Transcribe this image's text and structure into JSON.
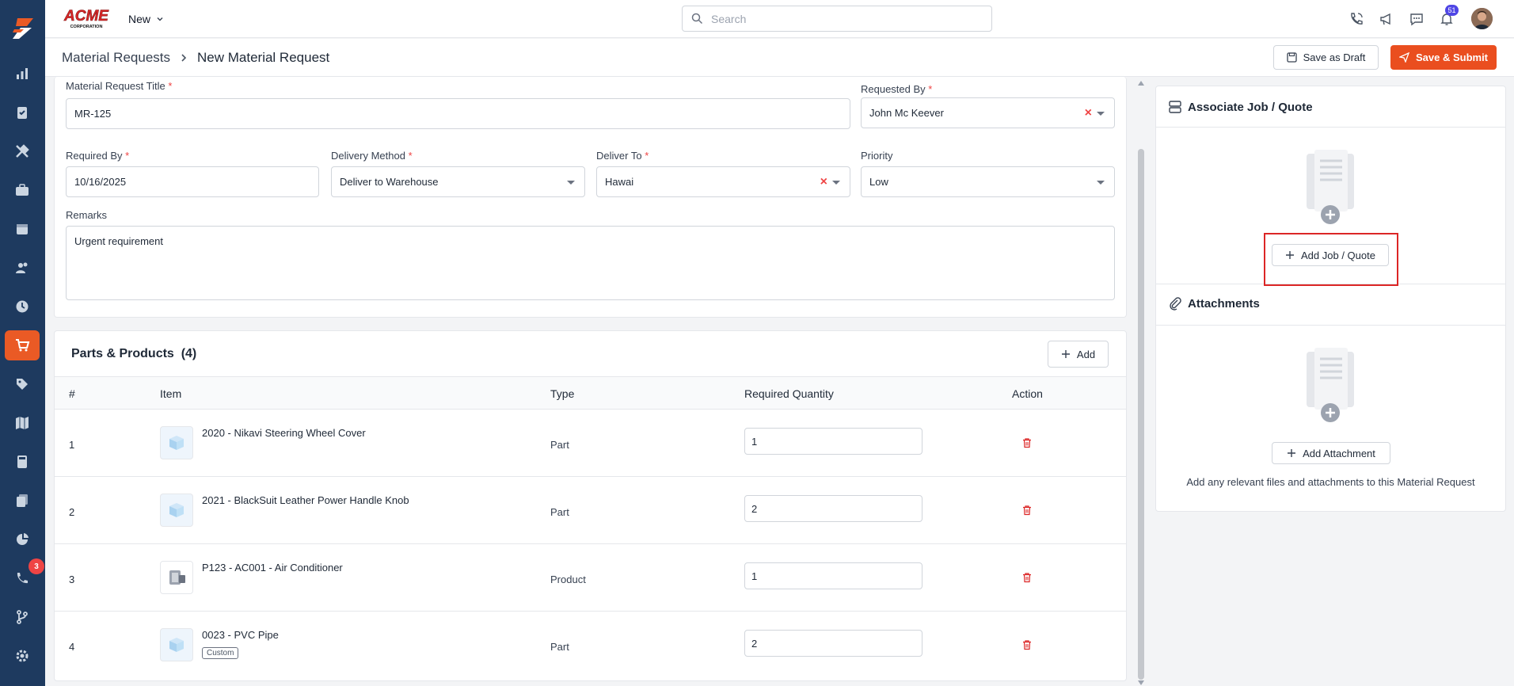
{
  "app": {
    "brand": "ACME CORPORATION",
    "new_menu_label": "New",
    "search_placeholder": "Search",
    "notification_count": "51",
    "sidebar_calls_badge": "3",
    "accent_color": "#ea5a25",
    "sidebar_color": "#1e3a5f"
  },
  "sidebar": {
    "items": [
      {
        "icon": "dashboard-icon"
      },
      {
        "icon": "clipboard-check-icon"
      },
      {
        "icon": "tools-icon"
      },
      {
        "icon": "briefcase-icon"
      },
      {
        "icon": "calendar-icon"
      },
      {
        "icon": "users-icon"
      },
      {
        "icon": "clock-icon"
      },
      {
        "icon": "cart-icon",
        "active": true
      },
      {
        "icon": "tag-icon"
      },
      {
        "icon": "map-icon"
      },
      {
        "icon": "calculator-icon"
      },
      {
        "icon": "documents-icon"
      },
      {
        "icon": "pie-chart-icon"
      },
      {
        "icon": "phone-icon"
      },
      {
        "icon": "git-branch-icon"
      },
      {
        "icon": "settings-icon"
      }
    ]
  },
  "header": {
    "breadcrumb_parent": "Material Requests",
    "breadcrumb_current": "New Material Request",
    "save_draft_label": "Save as Draft",
    "save_submit_label": "Save & Submit"
  },
  "form": {
    "title_label": "Material Request Title",
    "title_value": "MR-125",
    "requested_by_label": "Requested By",
    "requested_by_value": "John Mc Keever",
    "required_by_label": "Required By",
    "required_by_value": "10/16/2025",
    "delivery_method_label": "Delivery Method",
    "delivery_method_value": "Deliver to Warehouse",
    "deliver_to_label": "Deliver To",
    "deliver_to_value": "Hawai",
    "priority_label": "Priority",
    "priority_value": "Low",
    "remarks_label": "Remarks",
    "remarks_value": "Urgent requirement",
    "required_marker": "*"
  },
  "parts": {
    "title": "Parts & Products",
    "count": "(4)",
    "add_label": "Add",
    "columns": [
      "#",
      "Item",
      "Type",
      "Required Quantity",
      "Action"
    ],
    "rows": [
      {
        "num": "1",
        "item": "2020 - Nikavi Steering Wheel Cover",
        "type": "Part",
        "qty": "1",
        "thumb": "box-icon"
      },
      {
        "num": "2",
        "item": "2021 - BlackSuit Leather Power Handle Knob",
        "type": "Part",
        "qty": "2",
        "thumb": "box-icon"
      },
      {
        "num": "3",
        "item": "P123 - AC001 - Air Conditioner",
        "type": "Product",
        "qty": "1",
        "thumb": "product-photo-icon"
      },
      {
        "num": "4",
        "item": "0023 - PVC Pipe",
        "type": "Part",
        "qty": "2",
        "thumb": "box-icon",
        "tag": "Custom"
      }
    ]
  },
  "right": {
    "job_title": "Associate Job / Quote",
    "job_button": "Add Job / Quote",
    "attach_title": "Attachments",
    "attach_button": "Add Attachment",
    "attach_hint": "Add any relevant files and attachments to this Material Request",
    "highlight_color": "#dc2626"
  }
}
